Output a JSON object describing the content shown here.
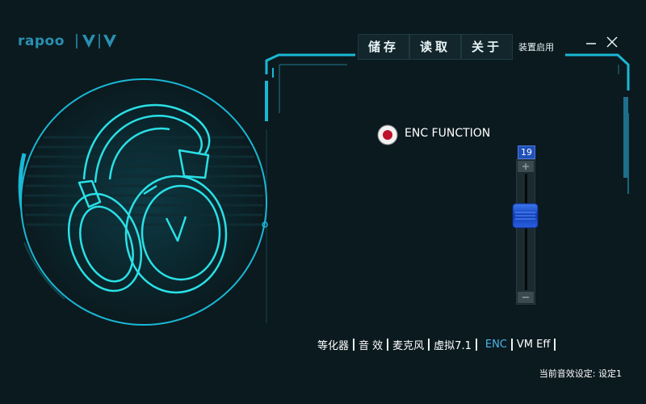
{
  "header": {
    "brand": "rapoo",
    "buttons": {
      "save": "储存",
      "load": "读取",
      "about": "关于"
    },
    "device_enable": "装置启用"
  },
  "enc": {
    "label": "ENC FUNCTION",
    "slider_value": "19",
    "slider_level": 0.6
  },
  "tabs": [
    {
      "label": "等化器"
    },
    {
      "label": "音 效"
    },
    {
      "label": "麦克风"
    },
    {
      "label": "虚拟7.1"
    },
    {
      "label": "ENC"
    },
    {
      "label": "VM Eff"
    }
  ],
  "active_tab": "ENC",
  "footer": {
    "current_setting_label": "当前音效设定:",
    "current_setting_value": "设定1"
  },
  "colors": {
    "background": "#0b1a1f",
    "accent_cyan": "#19b8d4",
    "slider_blue": "#1f50b8",
    "enc_red": "#c0102a"
  },
  "icons": [
    "rapoo-logo-icon",
    "v-brand-icon",
    "minimize-icon",
    "close-icon",
    "headset-icon",
    "radio-icon",
    "plus-icon",
    "minus-icon"
  ]
}
